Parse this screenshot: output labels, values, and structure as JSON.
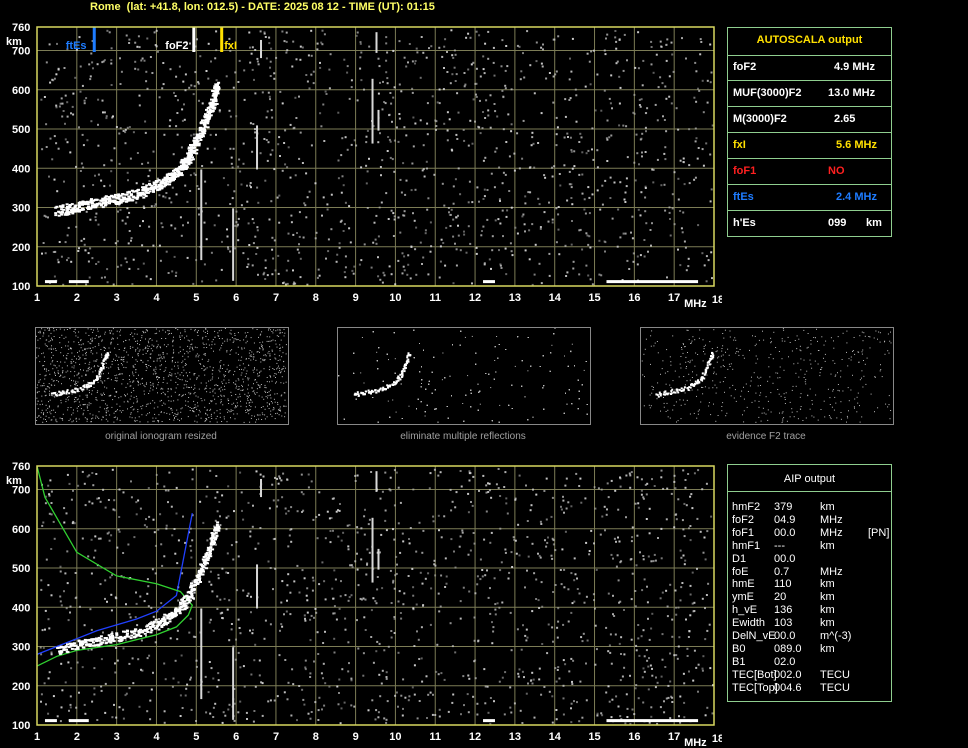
{
  "header": {
    "title": "Rome  (lat: +41.8, lon: 012.5) - DATE: 2025 08 12 - TIME (UT): 01:15"
  },
  "colors": {
    "grid": "#7c7c56",
    "frame": "#d8d860",
    "panel_border": "#8fce8f",
    "ftes": "#1e7cff",
    "fxi": "#ffe000",
    "fof1": "#ff2020",
    "green_model": "#30d030",
    "blue_fit": "#2040ff"
  },
  "chart_data": [
    {
      "type": "scatter",
      "title": "",
      "xlabel": "MHz",
      "ylabel": "km",
      "xlim": [
        1,
        18
      ],
      "ylim": [
        100,
        760
      ],
      "x_ticks": [
        "1",
        "2",
        "3",
        "4",
        "5",
        "6",
        "7",
        "8",
        "9",
        "10",
        "11",
        "12",
        "13",
        "14",
        "15",
        "16",
        "17",
        "18"
      ],
      "y_ticks": [
        "100",
        "200",
        "300",
        "400",
        "500",
        "600",
        "700",
        "760"
      ],
      "grid": true,
      "markers": [
        {
          "label": "ftEs",
          "x": 2.4
        },
        {
          "label": "foF2",
          "x": 4.9
        },
        {
          "label": "fxI",
          "x": 5.6
        }
      ],
      "f2_trace": {
        "freq": [
          1.5,
          2.0,
          2.5,
          3.0,
          3.5,
          4.0,
          4.3,
          4.6,
          4.8,
          5.0,
          5.2,
          5.4,
          5.5
        ],
        "height": [
          300,
          312,
          322,
          332,
          345,
          365,
          385,
          410,
          440,
          480,
          530,
          580,
          620
        ]
      }
    },
    {
      "type": "line",
      "title": "",
      "xlabel": "MHz",
      "ylabel": "km",
      "xlim": [
        1,
        18
      ],
      "ylim": [
        100,
        760
      ],
      "x_ticks": [
        "1",
        "2",
        "3",
        "4",
        "5",
        "6",
        "7",
        "8",
        "9",
        "10",
        "11",
        "12",
        "13",
        "14",
        "15",
        "16",
        "17",
        "18"
      ],
      "y_ticks": [
        "100",
        "200",
        "300",
        "400",
        "500",
        "600",
        "700",
        "760"
      ],
      "grid": true,
      "series": [
        {
          "freq": [
            1.0,
            1.5,
            2.0,
            2.5,
            3.0,
            3.5,
            4.0,
            4.5,
            4.9
          ],
          "height": [
            280,
            300,
            320,
            340,
            355,
            370,
            390,
            430,
            640
          ]
        },
        {
          "freq": [
            1.0,
            1.5,
            2.0,
            3.0,
            4.0,
            4.5,
            4.8,
            4.9,
            4.6,
            4.0,
            3.0,
            2.0,
            1.2,
            1.0
          ],
          "height": [
            250,
            275,
            290,
            305,
            330,
            350,
            380,
            405,
            440,
            460,
            480,
            540,
            680,
            760
          ]
        }
      ]
    }
  ],
  "autoscala": {
    "title": "AUTOSCALA output",
    "rows": [
      {
        "label": "foF2",
        "value": "4.9 MHz"
      },
      {
        "label": "MUF(3000)F2",
        "value": "13.0 MHz"
      },
      {
        "label": "M(3000)F2",
        "value": "2.65"
      },
      {
        "label": "fxI",
        "value": "5.6 MHz"
      },
      {
        "label": "foF1",
        "value": "NO"
      },
      {
        "label": "ftEs",
        "value": "2.4 MHz"
      },
      {
        "label": "h'Es",
        "value": "099",
        "unit": "km"
      }
    ]
  },
  "captions": {
    "original": "original ionogram resized",
    "eliminate": "eliminate multiple reflections",
    "evidence": "evidence F2 trace"
  },
  "aip": {
    "title": "AIP output",
    "rows": [
      {
        "label": "hmF2",
        "value": "379",
        "unit": "km",
        "extra": ""
      },
      {
        "label": "foF2",
        "value": "04.9",
        "unit": "MHz",
        "extra": ""
      },
      {
        "label": "foF1",
        "value": "00.0",
        "unit": "MHz",
        "extra": "[PN]"
      },
      {
        "label": "hmF1",
        "value": "---",
        "unit": "km",
        "extra": ""
      },
      {
        "label": "D1",
        "value": "00.0",
        "unit": "",
        "extra": ""
      },
      {
        "label": "foE",
        "value": "0.7",
        "unit": "MHz",
        "extra": ""
      },
      {
        "label": "hmE",
        "value": "110",
        "unit": "km",
        "extra": ""
      },
      {
        "label": "ymE",
        "value": "20",
        "unit": "km",
        "extra": ""
      },
      {
        "label": "h_vE",
        "value": "136",
        "unit": "km",
        "extra": ""
      },
      {
        "label": "Ewidth",
        "value": "103",
        "unit": "km",
        "extra": ""
      },
      {
        "label": "DelN_vE",
        "value": "00.0",
        "unit": "m^(-3)",
        "extra": ""
      },
      {
        "label": "B0",
        "value": "089.0",
        "unit": "km",
        "extra": ""
      },
      {
        "label": "B1",
        "value": "02.0",
        "unit": "",
        "extra": ""
      },
      {
        "label": "TEC[Bot]",
        "value": "002.0",
        "unit": "TECU",
        "extra": ""
      },
      {
        "label": "TEC[Top]",
        "value": "004.6",
        "unit": "TECU",
        "extra": ""
      }
    ]
  }
}
